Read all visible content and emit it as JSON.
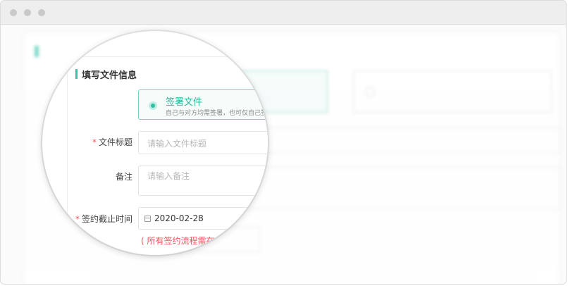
{
  "window": {
    "controls": [
      "close",
      "minimize",
      "maximize"
    ]
  },
  "section": {
    "title": "填写文件信息",
    "accent": "#2fc5a8"
  },
  "sign_option": {
    "title": "签署文件",
    "description": "自己与对方均需签署，也可仅自己签",
    "selected": true
  },
  "form": {
    "title_label": "文件标题",
    "title_placeholder": "请输入文件标题",
    "note_label": "备注",
    "note_placeholder": "请输入备注",
    "deadline_label": "签约截止时间",
    "deadline_value": "2020-02-28",
    "deadline_hint": "( 所有签约流程需在"
  },
  "colors": {
    "accent": "#2fc5a8",
    "required": "#f2545b",
    "warning": "#f2545b"
  }
}
